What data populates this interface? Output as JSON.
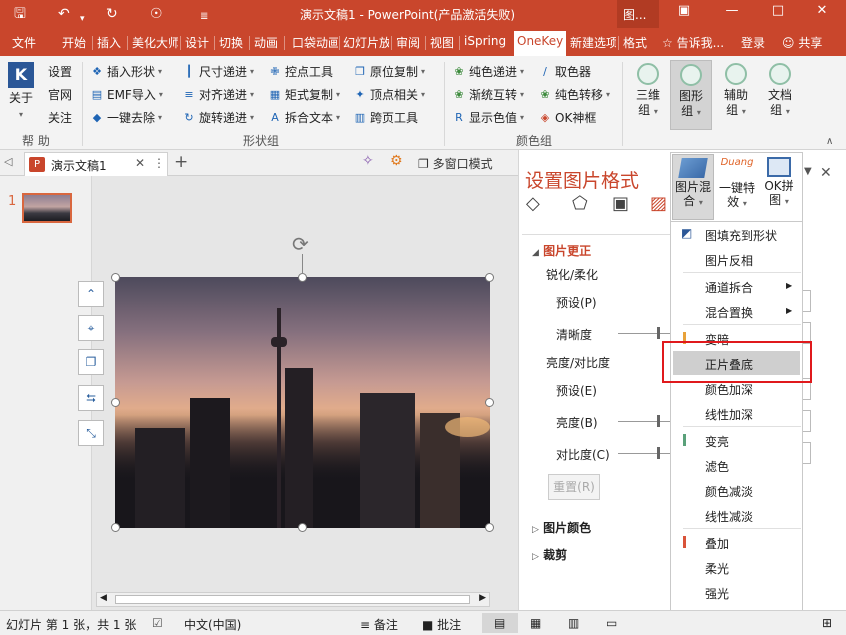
{
  "titlebar": {
    "title": "演示文稿1 - PowerPoint(产品激活失败)",
    "icons": [
      "save-icon",
      "undo-icon",
      "redo-icon",
      "start-from-beginning-icon",
      "customize-qat-icon"
    ],
    "right_label": "图...",
    "restore_icon": "restore-icon",
    "minimize_icon": "minimize-icon",
    "maximize_icon": "maximize-icon",
    "close_icon": "close-icon"
  },
  "ribbon_tabs": [
    "文件",
    "开始",
    "插入",
    "美化大师",
    "设计",
    "切换",
    "动画",
    "口袋动画",
    "幻灯片放映",
    "审阅",
    "视图",
    "iSpring",
    "OneKey",
    "新建选项卡",
    "格式"
  ],
  "ribbon_tabs_display": [
    "文件",
    "开始",
    "插入",
    "美化大师",
    "设计",
    "切换",
    "动画",
    "口袋动画",
    "幻灯片放",
    "审阅",
    "视图",
    "iSpring",
    "OneKey",
    "新建选项",
    "格式"
  ],
  "active_tab": "OneKey",
  "tell_me": "告诉我...",
  "signin": "登录",
  "share": "共享",
  "help_group": {
    "about": "关于",
    "settings": "设置",
    "website": "官网",
    "follow": "关注",
    "label": "帮 助"
  },
  "shape_group": {
    "col1": [
      "插入形状",
      "EMF导入",
      "一键去除"
    ],
    "col2": [
      "尺寸递进",
      "对齐递进",
      "旋转递进"
    ],
    "col3": [
      "控点工具",
      "矩式复制",
      "拆合文本"
    ],
    "col4": [
      "原位复制",
      "顶点相关",
      "跨页工具"
    ],
    "label": "形状组"
  },
  "color_group": {
    "col1": [
      "纯色递进",
      "渐统互转",
      "显示色值"
    ],
    "col2": [
      "取色器",
      "纯色转移",
      "OK神框"
    ],
    "label": "颜色组"
  },
  "big_buttons": [
    {
      "l1": "三维",
      "l2": "组"
    },
    {
      "l1": "图形",
      "l2": "组"
    },
    {
      "l1": "辅助",
      "l2": "组"
    },
    {
      "l1": "文档",
      "l2": "组"
    }
  ],
  "doc_tab": "演示文稿1",
  "multiwindow": "多窗口模式",
  "slide_number": "1",
  "pane": {
    "title": "设置图片格式",
    "section_correction": "图片更正",
    "sharpen": "锐化/柔化",
    "preset1": "预设(P)",
    "clarity": "清晰度",
    "brightness_contrast": "亮度/对比度",
    "preset2": "预设(E)",
    "brightness": "亮度(B)",
    "contrast": "对比度(C)",
    "reset": "重置(R)",
    "section_color": "图片颜色",
    "section_crop": "裁剪"
  },
  "popup_buttons": [
    {
      "l1": "图片混",
      "l2": "合"
    },
    {
      "l1": "一键特",
      "l2": "效"
    },
    {
      "l1": "OK拼",
      "l2": "图"
    }
  ],
  "duang_label": "Duang",
  "menu_items": [
    {
      "label": "图填充到形状",
      "bar": ""
    },
    {
      "label": "图片反相",
      "bar": ""
    },
    {
      "label": "通道拆合",
      "bar": "",
      "arrow": "▶"
    },
    {
      "label": "混合置换",
      "bar": "",
      "arrow": "▶"
    },
    {
      "label": "变暗",
      "bar": "#e8a23a"
    },
    {
      "label": "正片叠底",
      "bar": "",
      "highlight": true
    },
    {
      "label": "颜色加深",
      "bar": ""
    },
    {
      "label": "线性加深",
      "bar": ""
    },
    {
      "label": "变亮",
      "bar": "#5aa17a"
    },
    {
      "label": "滤色",
      "bar": ""
    },
    {
      "label": "颜色减淡",
      "bar": ""
    },
    {
      "label": "线性减淡",
      "bar": ""
    },
    {
      "label": "叠加",
      "bar": "#d9533a"
    },
    {
      "label": "柔光",
      "bar": ""
    },
    {
      "label": "强光",
      "bar": ""
    },
    {
      "label": "亮光",
      "bar": ""
    }
  ],
  "status": {
    "slide": "幻灯片 第 1 张，共 1 张",
    "lang": "中文(中国)",
    "notes": "备注",
    "comments": "批注"
  }
}
